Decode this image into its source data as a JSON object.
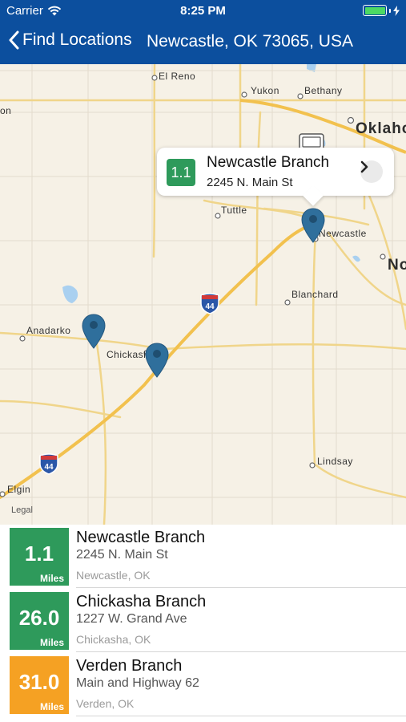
{
  "status_bar": {
    "carrier": "Carrier",
    "time": "8:25 PM"
  },
  "nav": {
    "back_label": "Find Locations",
    "title": "Newcastle, OK 73065, USA"
  },
  "map": {
    "place_labels": [
      "El Reno",
      "Yukon",
      "Bethany",
      "Oklaho",
      "on",
      "Tuttle",
      "Newcastle",
      "No",
      "Blanchard",
      "Anadarko",
      "Chickasha",
      "Lindsay",
      "Elgin"
    ],
    "highway_shields": [
      "44",
      "44"
    ],
    "legal": "Legal",
    "callout": {
      "badge": "1.1",
      "name": "Newcastle Branch",
      "address": "2245 N. Main St"
    }
  },
  "locations": [
    {
      "distance": "1.1",
      "unit": "Miles",
      "name": "Newcastle Branch",
      "address": "2245 N. Main St",
      "city": "Newcastle, OK",
      "color": "#2e9a5b"
    },
    {
      "distance": "26.0",
      "unit": "Miles",
      "name": "Chickasha Branch",
      "address": "1227 W. Grand Ave",
      "city": "Chickasha, OK",
      "color": "#2e9a5b"
    },
    {
      "distance": "31.0",
      "unit": "Miles",
      "name": "Verden Branch",
      "address": "Main and Highway 62",
      "city": "Verden, OK",
      "color": "#f5a123"
    }
  ],
  "colors": {
    "nav_background": "#0c4f9e",
    "pin": "#2f6f9c",
    "green_badge": "#2e9a5b",
    "orange_badge": "#f5a123"
  }
}
